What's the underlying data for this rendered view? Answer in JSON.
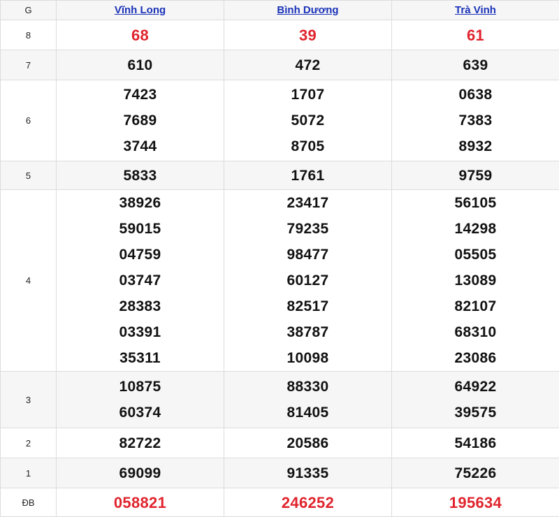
{
  "header": {
    "prize_col": "G",
    "provinces": [
      "Vĩnh Long",
      "Bình Dương",
      "Trà Vinh"
    ]
  },
  "rows": [
    {
      "label": "8",
      "values": [
        [
          "68"
        ],
        [
          "39"
        ],
        [
          "61"
        ]
      ]
    },
    {
      "label": "7",
      "values": [
        [
          "610"
        ],
        [
          "472"
        ],
        [
          "639"
        ]
      ]
    },
    {
      "label": "6",
      "values": [
        [
          "7423",
          "7689",
          "3744"
        ],
        [
          "1707",
          "5072",
          "8705"
        ],
        [
          "0638",
          "7383",
          "8932"
        ]
      ]
    },
    {
      "label": "5",
      "values": [
        [
          "5833"
        ],
        [
          "1761"
        ],
        [
          "9759"
        ]
      ]
    },
    {
      "label": "4",
      "values": [
        [
          "38926",
          "59015",
          "04759",
          "03747",
          "28383",
          "03391",
          "35311"
        ],
        [
          "23417",
          "79235",
          "98477",
          "60127",
          "82517",
          "38787",
          "10098"
        ],
        [
          "56105",
          "14298",
          "05505",
          "13089",
          "82107",
          "68310",
          "23086"
        ]
      ]
    },
    {
      "label": "3",
      "values": [
        [
          "10875",
          "60374"
        ],
        [
          "88330",
          "81405"
        ],
        [
          "64922",
          "39575"
        ]
      ]
    },
    {
      "label": "2",
      "values": [
        [
          "82722"
        ],
        [
          "20586"
        ],
        [
          "54186"
        ]
      ]
    },
    {
      "label": "1",
      "values": [
        [
          "69099"
        ],
        [
          "91335"
        ],
        [
          "75226"
        ]
      ]
    },
    {
      "label": "ĐB",
      "values": [
        [
          "058821"
        ],
        [
          "246252"
        ],
        [
          "195634"
        ]
      ]
    }
  ],
  "colors": {
    "highlight": "#e0242d",
    "link": "#1a32b8",
    "alt_row": "#f6f6f6"
  }
}
